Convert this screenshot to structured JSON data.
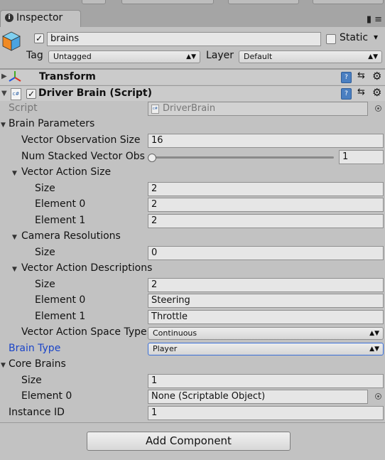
{
  "tab": {
    "label": "Inspector",
    "controls": "▮ ≡"
  },
  "object": {
    "name": "brains",
    "static_label": "Static",
    "static_arrow": "▾",
    "active_check": "✓",
    "tag_label": "Tag",
    "tag_value": "Untagged",
    "layer_label": "Layer",
    "layer_value": "Default"
  },
  "components": {
    "transform": {
      "title": "Transform"
    },
    "driver": {
      "title": "Driver Brain (Script)",
      "enabled_check": "✓"
    }
  },
  "icons": {
    "help": "?",
    "settings": "⚙",
    "preset": "⇆",
    "script_tag": "c#"
  },
  "script": {
    "label": "Script",
    "value": "DriverBrain"
  },
  "brain_parameters": {
    "label": "Brain Parameters",
    "vector_observation_size": {
      "label": "Vector Observation Size",
      "value": "16"
    },
    "num_stacked": {
      "label": "Num Stacked Vector Obs",
      "value": "1",
      "slider_fraction": 0
    },
    "vector_action_size": {
      "label": "Vector Action Size",
      "size_label": "Size",
      "size": "2",
      "elements": [
        {
          "label": "Element 0",
          "value": "2"
        },
        {
          "label": "Element 1",
          "value": "2"
        }
      ]
    },
    "camera_resolutions": {
      "label": "Camera Resolutions",
      "size_label": "Size",
      "size": "0"
    },
    "vector_action_descriptions": {
      "label": "Vector Action Descriptions",
      "size_label": "Size",
      "size": "2",
      "elements": [
        {
          "label": "Element 0",
          "value": "Steering"
        },
        {
          "label": "Element 1",
          "value": "Throttle"
        }
      ]
    },
    "vector_action_space_type": {
      "label": "Vector Action Space Type",
      "value": "Continuous"
    }
  },
  "brain_type": {
    "label": "Brain Type",
    "value": "Player"
  },
  "core_brains": {
    "label": "Core Brains",
    "size_label": "Size",
    "size": "1",
    "element0_label": "Element 0",
    "element0_value": "None (Scriptable Object)"
  },
  "instance_id": {
    "label": "Instance ID",
    "value": "1"
  },
  "add_component": "Add Component",
  "colors": {
    "link_blue": "#1a44c8",
    "panel": "#c2c2c2"
  }
}
